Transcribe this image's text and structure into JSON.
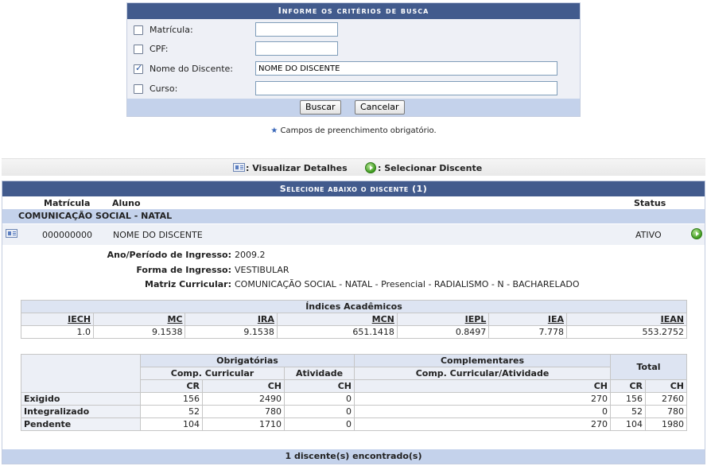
{
  "search": {
    "caption": "Informe os critérios de busca",
    "fields": [
      {
        "label": "Matrícula:",
        "value": "",
        "checked": false
      },
      {
        "label": "CPF:",
        "value": "",
        "checked": false
      },
      {
        "label": "Nome do Discente:",
        "value": "NOME DO DISCENTE",
        "checked": true
      },
      {
        "label": "Curso:",
        "value": "",
        "checked": false
      }
    ],
    "buttons": {
      "search": "Buscar",
      "cancel": "Cancelar"
    },
    "required_note": "Campos de preenchimento obrigatório."
  },
  "legend": {
    "view_details": ": Visualizar Detalhes",
    "select_student": ": Selecionar Discente"
  },
  "results": {
    "caption": "Selecione abaixo o discente (1)",
    "headers": {
      "matricula": "Matrícula",
      "aluno": "Aluno",
      "status": "Status"
    },
    "course": "COMUNICAÇÃO SOCIAL - NATAL",
    "student": {
      "matricula": "000000000",
      "nome": "NOME DO DISCENTE",
      "status": "ATIVO"
    },
    "details": [
      {
        "label": "Ano/Período de Ingresso:",
        "value": "2009.2"
      },
      {
        "label": "Forma de Ingresso:",
        "value": "VESTIBULAR"
      },
      {
        "label": "Matriz Curricular:",
        "value": "COMUNICAÇÃO SOCIAL - NATAL - Presencial - RADIALISMO - N - BACHARELADO"
      }
    ],
    "indices": {
      "title": "Índices Acadêmicos",
      "headers": [
        "IECH",
        "MC",
        "IRA",
        "MCN",
        "IEPL",
        "IEA",
        "IEAN"
      ],
      "values": [
        "1.0",
        "9.1538",
        "9.1538",
        "651.1418",
        "0.8497",
        "7.778",
        "553.2752"
      ]
    },
    "workload": {
      "obrigatorias": "Obrigatórias",
      "complementares": "Complementares",
      "total": "Total",
      "comp_curricular": "Comp. Curricular",
      "atividade": "Atividade",
      "comp_atividade": "Comp. Curricular/Atividade",
      "cr": "CR",
      "ch": "CH",
      "rows": [
        {
          "label": "Exigido",
          "values": [
            "156",
            "2490",
            "0",
            "270",
            "156",
            "2760"
          ]
        },
        {
          "label": "Integralizado",
          "values": [
            "52",
            "780",
            "0",
            "0",
            "52",
            "780"
          ]
        },
        {
          "label": "Pendente",
          "values": [
            "104",
            "1710",
            "0",
            "270",
            "104",
            "1980"
          ]
        }
      ]
    },
    "footer": "1 discente(s) encontrado(s)"
  }
}
